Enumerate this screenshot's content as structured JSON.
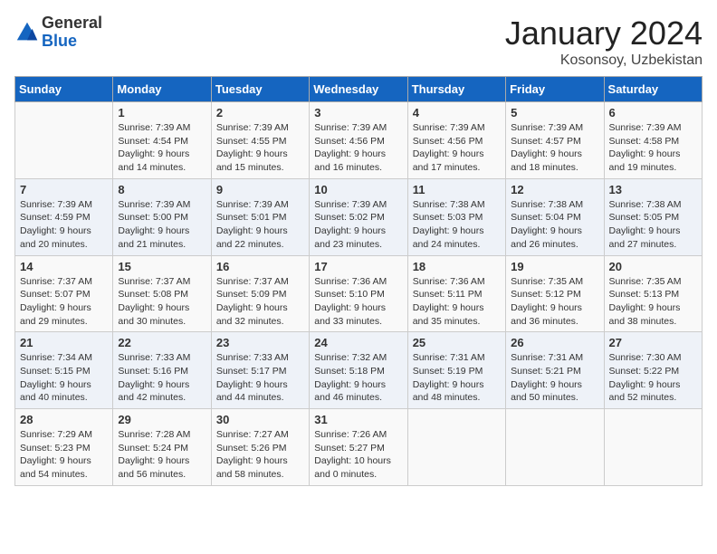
{
  "header": {
    "logo_general": "General",
    "logo_blue": "Blue",
    "month": "January 2024",
    "location": "Kosonsoy, Uzbekistan"
  },
  "days_of_week": [
    "Sunday",
    "Monday",
    "Tuesday",
    "Wednesday",
    "Thursday",
    "Friday",
    "Saturday"
  ],
  "weeks": [
    [
      {
        "day": "",
        "content": ""
      },
      {
        "day": "1",
        "content": "Sunrise: 7:39 AM\nSunset: 4:54 PM\nDaylight: 9 hours\nand 14 minutes."
      },
      {
        "day": "2",
        "content": "Sunrise: 7:39 AM\nSunset: 4:55 PM\nDaylight: 9 hours\nand 15 minutes."
      },
      {
        "day": "3",
        "content": "Sunrise: 7:39 AM\nSunset: 4:56 PM\nDaylight: 9 hours\nand 16 minutes."
      },
      {
        "day": "4",
        "content": "Sunrise: 7:39 AM\nSunset: 4:56 PM\nDaylight: 9 hours\nand 17 minutes."
      },
      {
        "day": "5",
        "content": "Sunrise: 7:39 AM\nSunset: 4:57 PM\nDaylight: 9 hours\nand 18 minutes."
      },
      {
        "day": "6",
        "content": "Sunrise: 7:39 AM\nSunset: 4:58 PM\nDaylight: 9 hours\nand 19 minutes."
      }
    ],
    [
      {
        "day": "7",
        "content": "Sunrise: 7:39 AM\nSunset: 4:59 PM\nDaylight: 9 hours\nand 20 minutes."
      },
      {
        "day": "8",
        "content": "Sunrise: 7:39 AM\nSunset: 5:00 PM\nDaylight: 9 hours\nand 21 minutes."
      },
      {
        "day": "9",
        "content": "Sunrise: 7:39 AM\nSunset: 5:01 PM\nDaylight: 9 hours\nand 22 minutes."
      },
      {
        "day": "10",
        "content": "Sunrise: 7:39 AM\nSunset: 5:02 PM\nDaylight: 9 hours\nand 23 minutes."
      },
      {
        "day": "11",
        "content": "Sunrise: 7:38 AM\nSunset: 5:03 PM\nDaylight: 9 hours\nand 24 minutes."
      },
      {
        "day": "12",
        "content": "Sunrise: 7:38 AM\nSunset: 5:04 PM\nDaylight: 9 hours\nand 26 minutes."
      },
      {
        "day": "13",
        "content": "Sunrise: 7:38 AM\nSunset: 5:05 PM\nDaylight: 9 hours\nand 27 minutes."
      }
    ],
    [
      {
        "day": "14",
        "content": "Sunrise: 7:37 AM\nSunset: 5:07 PM\nDaylight: 9 hours\nand 29 minutes."
      },
      {
        "day": "15",
        "content": "Sunrise: 7:37 AM\nSunset: 5:08 PM\nDaylight: 9 hours\nand 30 minutes."
      },
      {
        "day": "16",
        "content": "Sunrise: 7:37 AM\nSunset: 5:09 PM\nDaylight: 9 hours\nand 32 minutes."
      },
      {
        "day": "17",
        "content": "Sunrise: 7:36 AM\nSunset: 5:10 PM\nDaylight: 9 hours\nand 33 minutes."
      },
      {
        "day": "18",
        "content": "Sunrise: 7:36 AM\nSunset: 5:11 PM\nDaylight: 9 hours\nand 35 minutes."
      },
      {
        "day": "19",
        "content": "Sunrise: 7:35 AM\nSunset: 5:12 PM\nDaylight: 9 hours\nand 36 minutes."
      },
      {
        "day": "20",
        "content": "Sunrise: 7:35 AM\nSunset: 5:13 PM\nDaylight: 9 hours\nand 38 minutes."
      }
    ],
    [
      {
        "day": "21",
        "content": "Sunrise: 7:34 AM\nSunset: 5:15 PM\nDaylight: 9 hours\nand 40 minutes."
      },
      {
        "day": "22",
        "content": "Sunrise: 7:33 AM\nSunset: 5:16 PM\nDaylight: 9 hours\nand 42 minutes."
      },
      {
        "day": "23",
        "content": "Sunrise: 7:33 AM\nSunset: 5:17 PM\nDaylight: 9 hours\nand 44 minutes."
      },
      {
        "day": "24",
        "content": "Sunrise: 7:32 AM\nSunset: 5:18 PM\nDaylight: 9 hours\nand 46 minutes."
      },
      {
        "day": "25",
        "content": "Sunrise: 7:31 AM\nSunset: 5:19 PM\nDaylight: 9 hours\nand 48 minutes."
      },
      {
        "day": "26",
        "content": "Sunrise: 7:31 AM\nSunset: 5:21 PM\nDaylight: 9 hours\nand 50 minutes."
      },
      {
        "day": "27",
        "content": "Sunrise: 7:30 AM\nSunset: 5:22 PM\nDaylight: 9 hours\nand 52 minutes."
      }
    ],
    [
      {
        "day": "28",
        "content": "Sunrise: 7:29 AM\nSunset: 5:23 PM\nDaylight: 9 hours\nand 54 minutes."
      },
      {
        "day": "29",
        "content": "Sunrise: 7:28 AM\nSunset: 5:24 PM\nDaylight: 9 hours\nand 56 minutes."
      },
      {
        "day": "30",
        "content": "Sunrise: 7:27 AM\nSunset: 5:26 PM\nDaylight: 9 hours\nand 58 minutes."
      },
      {
        "day": "31",
        "content": "Sunrise: 7:26 AM\nSunset: 5:27 PM\nDaylight: 10 hours\nand 0 minutes."
      },
      {
        "day": "",
        "content": ""
      },
      {
        "day": "",
        "content": ""
      },
      {
        "day": "",
        "content": ""
      }
    ]
  ]
}
